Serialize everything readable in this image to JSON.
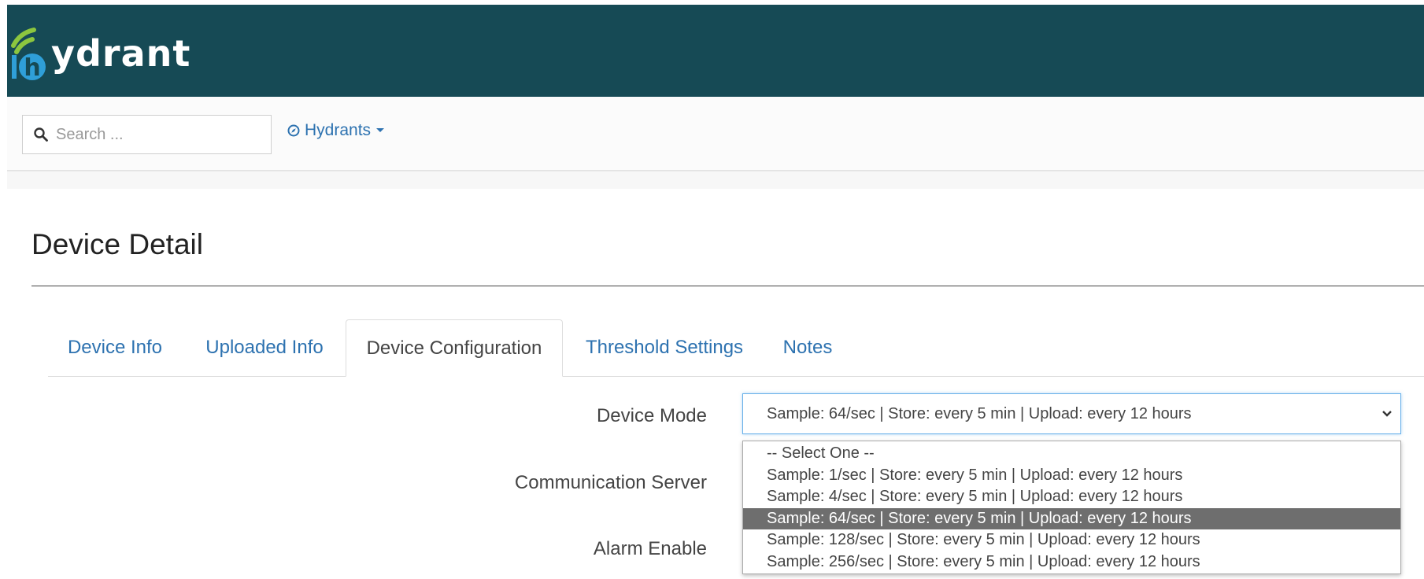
{
  "header": {
    "logo_text": "ydrant",
    "logo_letter": "h",
    "colors": {
      "header_bg": "#164a55",
      "logo_green": "#8cc63f",
      "logo_blue": "#2f9fd8"
    }
  },
  "navbar": {
    "search_placeholder": "Search ...",
    "search_icon": "search-icon",
    "hydrants_label": "Hydrants",
    "hydrants_icon": "compass-icon",
    "link_color": "#2d72b0"
  },
  "page": {
    "title": "Device Detail"
  },
  "tabs": [
    {
      "label": "Device Info",
      "active": false
    },
    {
      "label": "Uploaded Info",
      "active": false
    },
    {
      "label": "Device Configuration",
      "active": true
    },
    {
      "label": "Threshold Settings",
      "active": false
    },
    {
      "label": "Notes",
      "active": false
    }
  ],
  "form": {
    "device_mode_label": "Device Mode",
    "communication_server_label": "Communication Server",
    "alarm_enable_label": "Alarm Enable",
    "device_mode_value": "Sample: 64/sec | Store: every 5 min | Upload: every 12 hours",
    "device_mode_options": [
      "-- Select One --",
      "Sample: 1/sec | Store: every 5 min | Upload: every 12 hours",
      "Sample: 4/sec | Store: every 5 min | Upload: every 12 hours",
      "Sample: 64/sec | Store: every 5 min | Upload: every 12 hours",
      "Sample: 128/sec | Store: every 5 min | Upload: every 12 hours",
      "Sample: 256/sec | Store: every 5 min | Upload: every 12 hours"
    ],
    "selected_option_index": 3
  }
}
